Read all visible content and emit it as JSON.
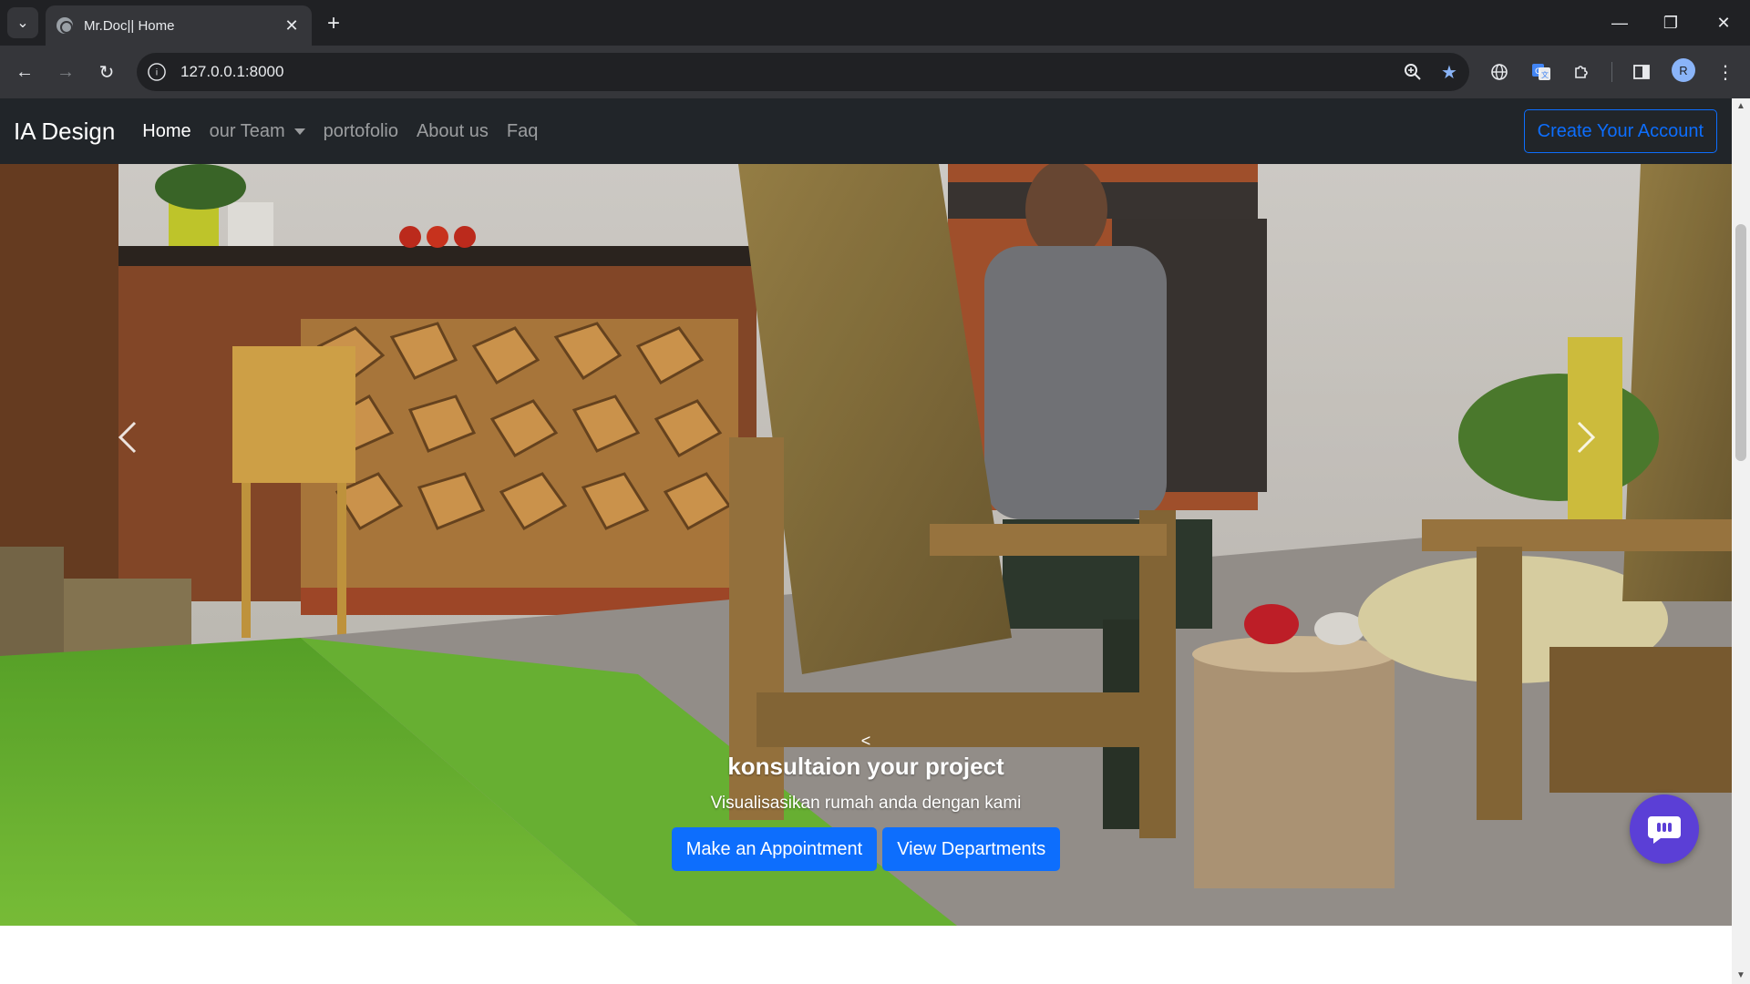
{
  "browser": {
    "tab_title": "Mr.Doc|| Home",
    "url": "127.0.0.1:8000",
    "tab_search_icon": "chevron-down-icon",
    "new_tab_icon": "plus-icon",
    "profile_initial": "R"
  },
  "navbar": {
    "brand": "IA Design",
    "links": [
      {
        "label": "Home",
        "active": true
      },
      {
        "label": "our Team",
        "dropdown": true
      },
      {
        "label": "portofolio"
      },
      {
        "label": "About us"
      },
      {
        "label": "Faq"
      }
    ],
    "account_button": "Create Your Account"
  },
  "hero": {
    "caption_prev": "<",
    "title": "konsultaion your project",
    "subtitle": "Visualisasikan rumah anda dengan kami",
    "buttons": [
      "Make an Appointment",
      "View Departments"
    ],
    "prev_icon": "chevron-left-icon",
    "next_icon": "chevron-right-icon"
  },
  "chat": {
    "icon": "chat-bubble-icon"
  },
  "colors": {
    "accent": "#0d6efd",
    "navbar": "#212529",
    "chat": "#5b3fd6"
  }
}
